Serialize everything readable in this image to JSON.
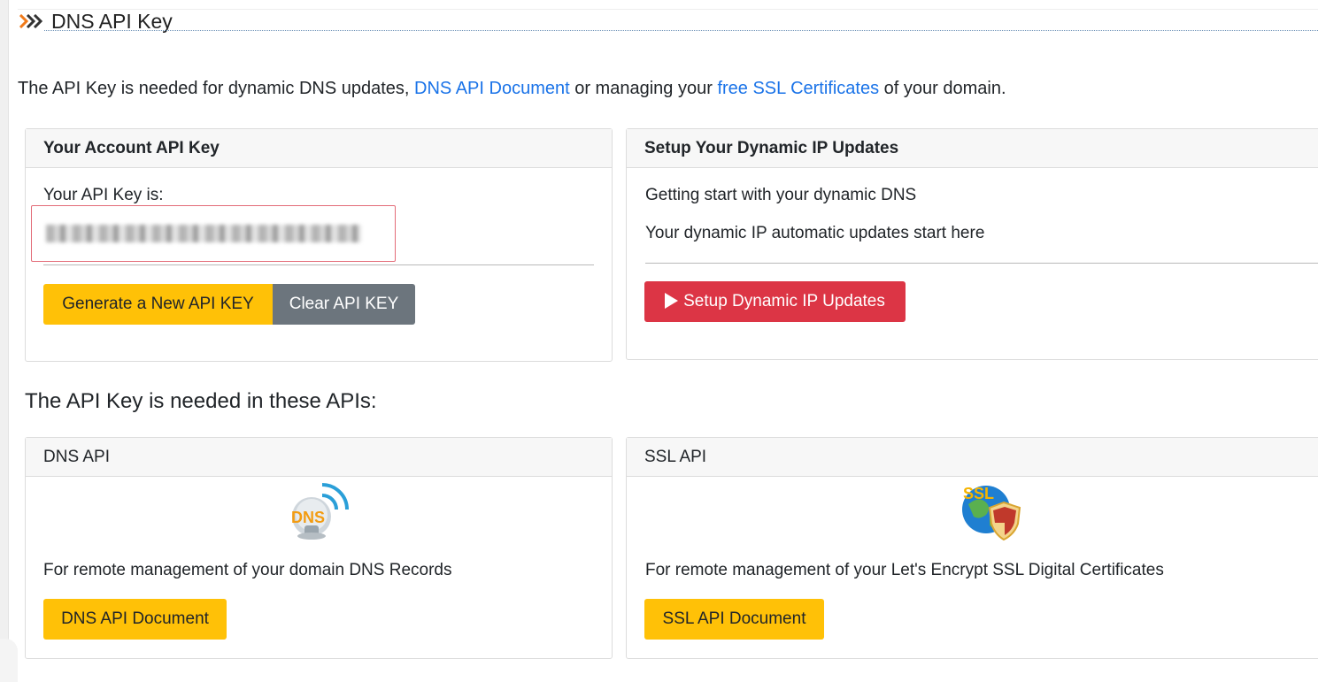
{
  "section": {
    "title": "DNS API Key"
  },
  "intro": {
    "prefix": "The API Key is needed for dynamic DNS updates,",
    "link_dns_api_document": "DNS API Document",
    "middle": "or managing your",
    "link_free_ssl": "free SSL Certificates",
    "suffix": "of your domain."
  },
  "account_card": {
    "header": "Your Account API Key",
    "label": "Your API Key is:",
    "api_key_value": "[blurred]",
    "generate_button": "Generate a New API KEY",
    "clear_button": "Clear API KEY"
  },
  "dynamic_card": {
    "header": "Setup Your Dynamic IP Updates",
    "line1": "Getting start with your dynamic DNS",
    "line2": "Your dynamic IP automatic updates start here",
    "setup_button": "Setup Dynamic IP Updates"
  },
  "apis_heading": "The API Key is needed in these APIs:",
  "dns_api_card": {
    "header": "DNS API",
    "icon": "dns-satellite-icon",
    "icon_text": "DNS",
    "description": "For remote management of your domain DNS Records",
    "button": "DNS API Document"
  },
  "ssl_api_card": {
    "header": "SSL API",
    "icon": "ssl-globe-shield-icon",
    "icon_text": "SSL",
    "description": "For remote management of your Let's Encrypt SSL Digital Certificates",
    "button": "SSL API Document"
  },
  "colors": {
    "accent_yellow": "#ffc107",
    "danger_red": "#dc3545",
    "secondary_gray": "#6c757d",
    "link_blue": "#1a73e8",
    "key_box_border": "#e36c78"
  }
}
